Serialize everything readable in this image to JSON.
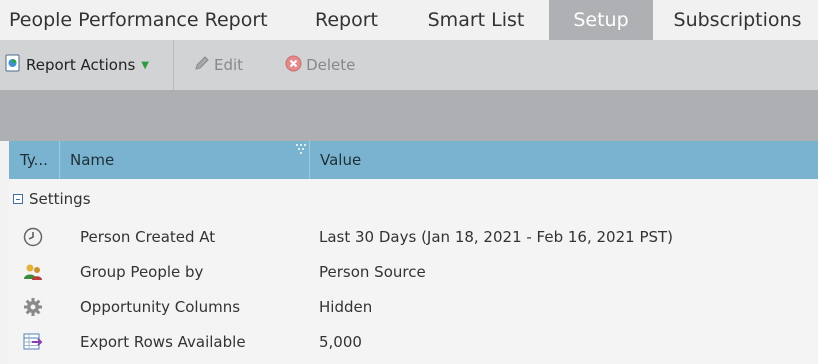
{
  "tabs": {
    "title": "People Performance Report",
    "report": "Report",
    "smart_list": "Smart List",
    "setup": "Setup",
    "subscriptions": "Subscriptions"
  },
  "toolbar": {
    "report_actions": "Report Actions",
    "edit": "Edit",
    "delete": "Delete"
  },
  "grid": {
    "columns": {
      "type": "Ty...",
      "name": "Name",
      "value": "Value"
    },
    "group": "Settings",
    "rows": [
      {
        "icon": "clock-icon",
        "name": "Person Created At",
        "value": "Last 30 Days (Jan 18, 2021 - Feb 16, 2021 PST)"
      },
      {
        "icon": "people-icon",
        "name": "Group People by",
        "value": "Person Source"
      },
      {
        "icon": "gear-icon",
        "name": "Opportunity Columns",
        "value": "Hidden"
      },
      {
        "icon": "export-rows-icon",
        "name": "Export Rows Available",
        "value": "5,000"
      }
    ]
  },
  "colors": {
    "active_tab": "#aeb0b3",
    "toolbar": "#d2d3d5",
    "grid_header": "#7ab3cf",
    "dropdown_caret": "#2e9b3a",
    "delete_icon": "#e06666"
  }
}
